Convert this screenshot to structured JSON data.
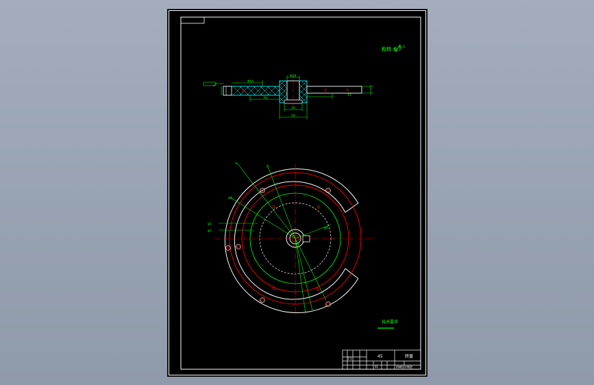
{
  "drawing": {
    "header_box_text": "",
    "roughness_top": "粗糙 余下",
    "roughness_value": "6.3",
    "section_dim_top": "Φ28",
    "section_label_left": "Φ54",
    "section_dim_bottom": "54",
    "section_dim_bottom2": "20",
    "section_right_dim": "12",
    "section_angle_label": "Ra",
    "plan_labels": [
      "A",
      "B",
      "φ1",
      "φ2",
      "φ3",
      "φ4"
    ],
    "note_title": "技术要求",
    "title_block": {
      "material": "45",
      "part_name": "转盘",
      "scale": "1:1",
      "company": "机械设计制造",
      "drawing_no": "01"
    }
  },
  "colors": {
    "sheet": "#000000",
    "border": "#ffffff",
    "green": "#00ff00",
    "red": "#ff0000",
    "cyan": "#00ffff",
    "white": "#ffffff"
  }
}
